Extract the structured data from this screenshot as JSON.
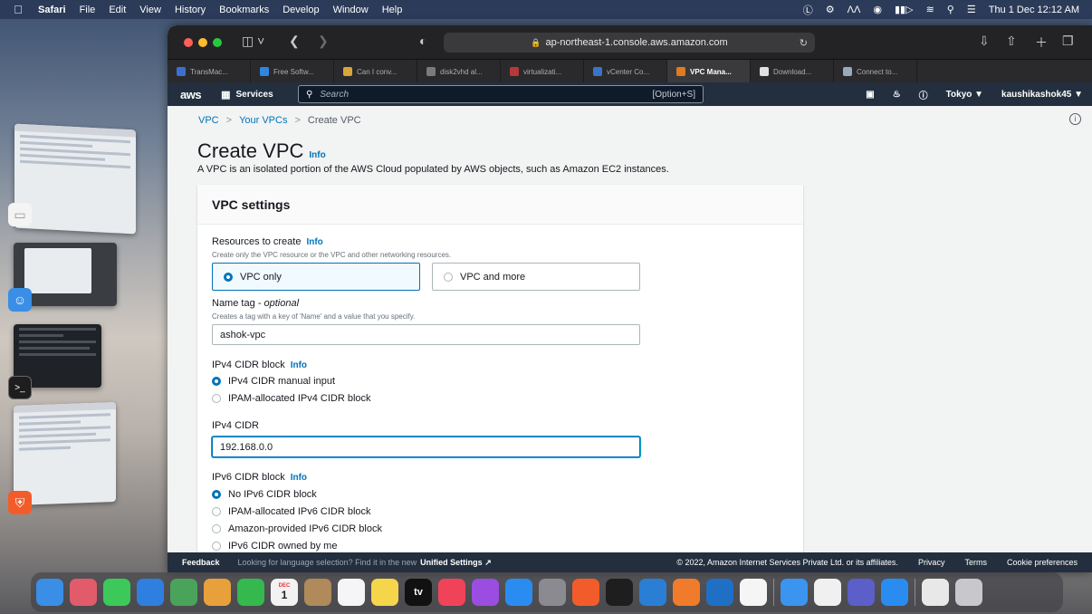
{
  "menubar": {
    "app_name": "Safari",
    "menus": [
      "File",
      "Edit",
      "View",
      "History",
      "Bookmarks",
      "Develop",
      "Window",
      "Help"
    ],
    "clock": "Thu 1 Dec  12:12 AM"
  },
  "browser": {
    "url": "ap-northeast-1.console.aws.amazon.com",
    "tabs": [
      {
        "label": "TransMac...",
        "color": "#3d6fd1"
      },
      {
        "label": "Free Softw...",
        "color": "#2f86de"
      },
      {
        "label": "Can I conv...",
        "color": "#d9a53a"
      },
      {
        "label": "disk2vhd al...",
        "color": "#7a7a7a"
      },
      {
        "label": "virtualizati...",
        "color": "#b33a3a"
      },
      {
        "label": "vCenter Co...",
        "color": "#3b73c9"
      },
      {
        "label": "VPC Mana...",
        "color": "#e07b22",
        "active": true
      },
      {
        "label": "Download...",
        "color": "#e0e0e0"
      },
      {
        "label": "Connect to...",
        "color": "#9aa8bb"
      }
    ]
  },
  "aws_nav": {
    "logo": "aws",
    "services": "Services",
    "search_placeholder": "Search",
    "search_shortcut": "[Option+S]",
    "region": "Tokyo ▼",
    "account": "kaushikashok45 ▼"
  },
  "breadcrumb": [
    "VPC",
    "Your VPCs",
    "Create VPC"
  ],
  "page": {
    "title": "Create VPC",
    "info": "Info",
    "description": "A VPC is an isolated portion of the AWS Cloud populated by AWS objects, such as Amazon EC2 instances."
  },
  "vpc_settings": {
    "heading": "VPC settings",
    "resources_label": "Resources to create",
    "resources_hint": "Create only the VPC resource or the VPC and other networking resources.",
    "resources_options": [
      "VPC only",
      "VPC and more"
    ],
    "name_tag_label": "Name tag",
    "name_tag_optional": "- optional",
    "name_tag_hint": "Creates a tag with a key of 'Name' and a value that you specify.",
    "name_tag_value": "ashok-vpc",
    "ipv4_block_label": "IPv4 CIDR block",
    "ipv4_block_options": [
      "IPv4 CIDR manual input",
      "IPAM-allocated IPv4 CIDR block"
    ],
    "ipv4_cidr_label": "IPv4 CIDR",
    "ipv4_cidr_value": "192.168.0.0",
    "ipv6_block_label": "IPv6 CIDR block",
    "ipv6_block_options": [
      "No IPv6 CIDR block",
      "IPAM-allocated IPv6 CIDR block",
      "Amazon-provided IPv6 CIDR block",
      "IPv6 CIDR owned by me"
    ]
  },
  "footer": {
    "feedback": "Feedback",
    "message": "Looking for language selection? Find it in the new",
    "unified": "Unified Settings",
    "copyright": "© 2022, Amazon Internet Services Private Ltd. or its affiliates.",
    "privacy": "Privacy",
    "terms": "Terms",
    "cookies": "Cookie preferences"
  },
  "dock": {
    "apps": [
      {
        "name": "finder",
        "color": "#3a8ee6"
      },
      {
        "name": "launchpad",
        "color": "#e25b6a"
      },
      {
        "name": "messages",
        "color": "#3cc95a"
      },
      {
        "name": "mail",
        "color": "#2f7fe0"
      },
      {
        "name": "maps",
        "color": "#4aa35a"
      },
      {
        "name": "photos",
        "color": "#e8a13a"
      },
      {
        "name": "facetime",
        "color": "#35b84e"
      },
      {
        "name": "calendar",
        "color": "#f2f2f2"
      },
      {
        "name": "contacts",
        "color": "#b08a5a"
      },
      {
        "name": "reminders",
        "color": "#f5f5f5"
      },
      {
        "name": "notes",
        "color": "#f5d54a"
      },
      {
        "name": "tv",
        "color": "#111111"
      },
      {
        "name": "music",
        "color": "#f0435a"
      },
      {
        "name": "podcasts",
        "color": "#9a4de0"
      },
      {
        "name": "app-store",
        "color": "#2a8cf0"
      },
      {
        "name": "system-preferences",
        "color": "#8a8a90"
      },
      {
        "name": "brave",
        "color": "#f25c2a"
      },
      {
        "name": "terminal",
        "color": "#1e1e1e"
      },
      {
        "name": "vscode",
        "color": "#2a7fd4"
      },
      {
        "name": "firefox",
        "color": "#f07b2a"
      },
      {
        "name": "outlook",
        "color": "#1f6fc5"
      },
      {
        "name": "document",
        "color": "#f5f5f5"
      },
      {
        "name": "safari",
        "color": "#3a94f0"
      },
      {
        "name": "textedit",
        "color": "#f0f0f0"
      },
      {
        "name": "teams",
        "color": "#5b5fc7"
      },
      {
        "name": "keynote",
        "color": "#2a8cf0"
      },
      {
        "name": "preview",
        "color": "#e8e8e8"
      },
      {
        "name": "trash",
        "color": "#c8c8cc"
      }
    ],
    "calendar_month": "DEC",
    "calendar_day": "1",
    "tv_label": "tv"
  }
}
